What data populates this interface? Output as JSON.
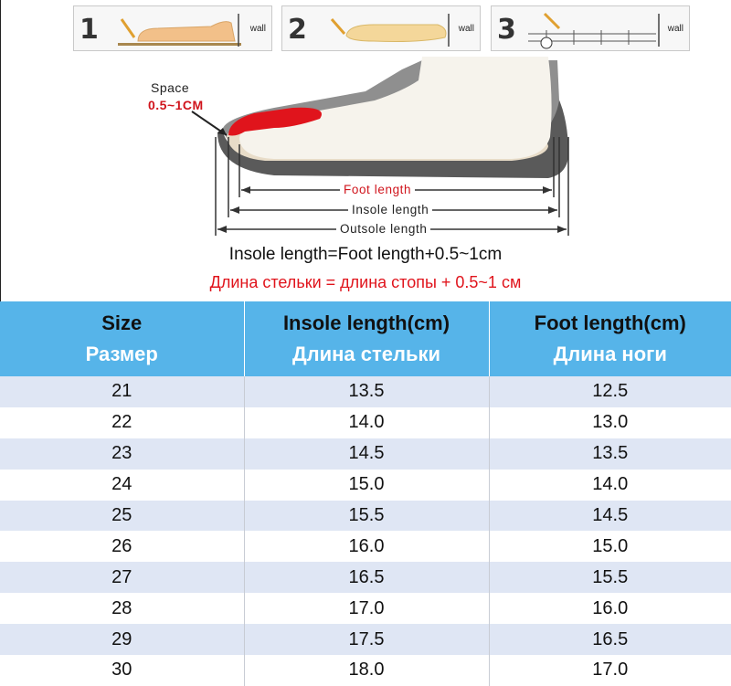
{
  "steps": [
    {
      "number": "1",
      "wall_label": "wall"
    },
    {
      "number": "2",
      "wall_label": "wall"
    },
    {
      "number": "3",
      "wall_label": "wall"
    }
  ],
  "diagram": {
    "space_label": "Space",
    "space_value": "0.5~1CM",
    "foot_length": "Foot length",
    "insole_length": "Insole length",
    "outsole_length": "Outsole length"
  },
  "formula_en": "Insole length=Foot length+0.5~1cm",
  "formula_ru": "Длина стельки = длина стопы + 0.5~1 см",
  "table": {
    "headers": [
      {
        "en": "Size",
        "ru": "Размер"
      },
      {
        "en": "Insole length(cm)",
        "ru": "Длина стельки"
      },
      {
        "en": "Foot length(cm)",
        "ru": "Длина ноги"
      }
    ],
    "rows": [
      [
        "21",
        "13.5",
        "12.5"
      ],
      [
        "22",
        "14.0",
        "13.0"
      ],
      [
        "23",
        "14.5",
        "13.5"
      ],
      [
        "24",
        "15.0",
        "14.0"
      ],
      [
        "25",
        "15.5",
        "14.5"
      ],
      [
        "26",
        "16.0",
        "15.0"
      ],
      [
        "27",
        "16.5",
        "15.5"
      ],
      [
        "28",
        "17.0",
        "16.0"
      ],
      [
        "29",
        "17.5",
        "16.5"
      ],
      [
        "30",
        "18.0",
        "17.0"
      ]
    ]
  },
  "colors": {
    "header_bg": "#56b4e9",
    "stripe_bg": "#dfe6f4",
    "accent_red": "#e0141c"
  }
}
